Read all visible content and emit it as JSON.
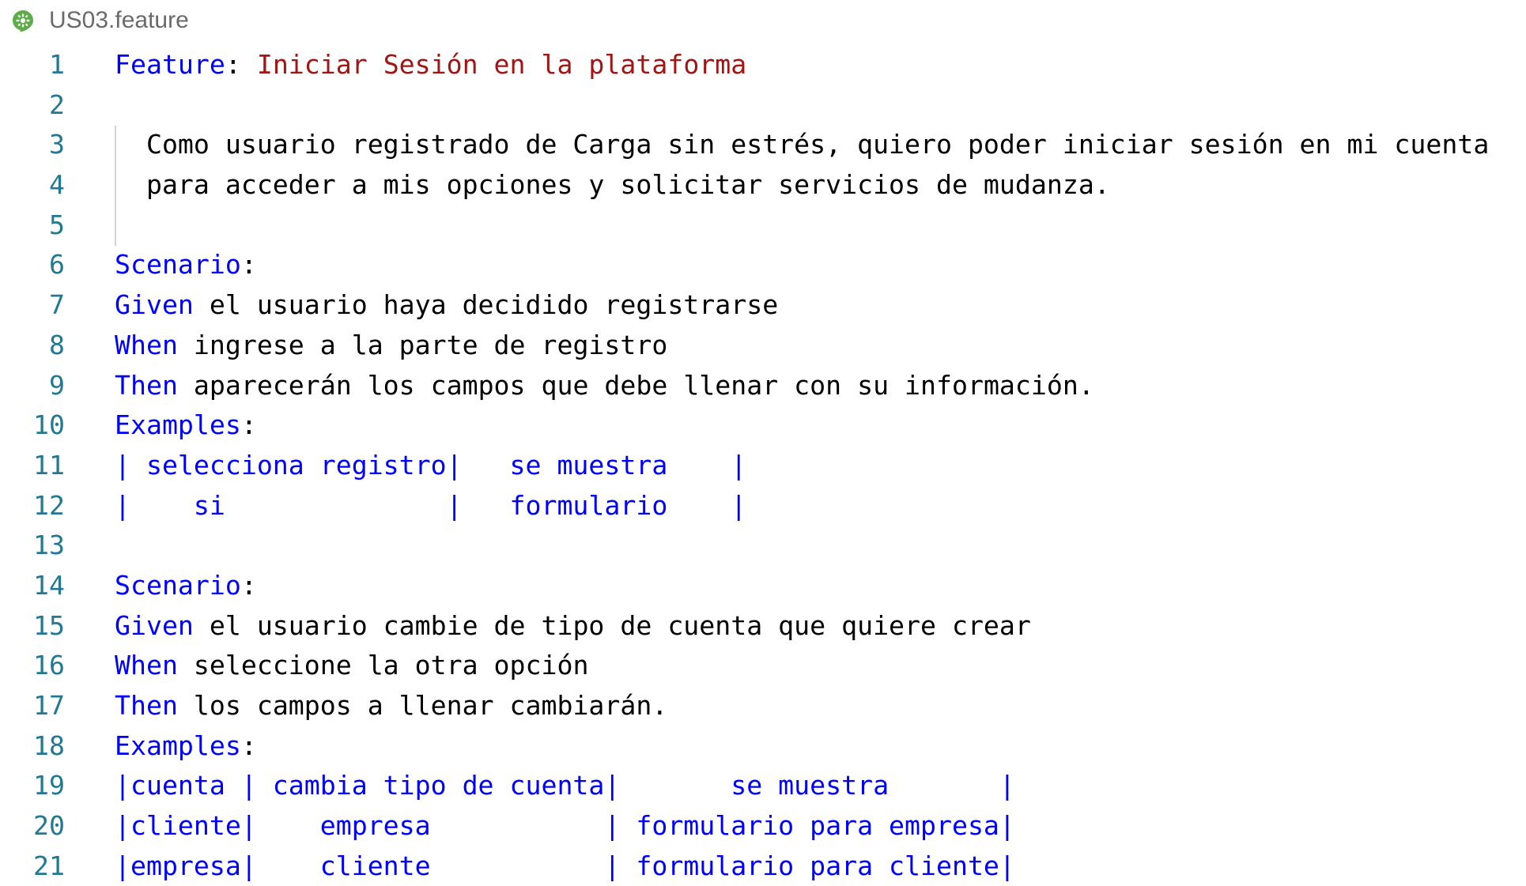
{
  "tab": {
    "icon": "cucumber-icon",
    "file_name": "US03.feature"
  },
  "colors": {
    "keyword": "#0000ff",
    "feature_title": "#a31515",
    "line_number": "#237893",
    "text": "#000000"
  },
  "lines": [
    {
      "n": "1",
      "kw": "Feature",
      "sep": ": ",
      "title": "Iniciar Sesión en la plataforma"
    },
    {
      "n": "2"
    },
    {
      "n": "3",
      "text": "  Como usuario registrado de Carga sin estrés, quiero poder iniciar sesión en mi cuenta"
    },
    {
      "n": "4",
      "text": "  para acceder a mis opciones y solicitar servicios de mudanza."
    },
    {
      "n": "5"
    },
    {
      "n": "6",
      "kw": "Scenario",
      "rest": ":"
    },
    {
      "n": "7",
      "kw": "Given",
      "rest": " el usuario haya decidido registrarse"
    },
    {
      "n": "8",
      "kw": "When",
      "rest": " ingrese a la parte de registro"
    },
    {
      "n": "9",
      "kw": "Then",
      "rest": " aparecerán los campos que debe llenar con su información."
    },
    {
      "n": "10",
      "kw": "Examples",
      "rest": ":"
    },
    {
      "n": "11",
      "table": "| selecciona registro|   se muestra    |"
    },
    {
      "n": "12",
      "table": "|    si              |   formulario    |"
    },
    {
      "n": "13"
    },
    {
      "n": "14",
      "kw": "Scenario",
      "rest": ":"
    },
    {
      "n": "15",
      "kw": "Given",
      "rest": " el usuario cambie de tipo de cuenta que quiere crear"
    },
    {
      "n": "16",
      "kw": "When",
      "rest": " seleccione la otra opción"
    },
    {
      "n": "17",
      "kw": "Then",
      "rest": " los campos a llenar cambiarán."
    },
    {
      "n": "18",
      "kw": "Examples",
      "rest": ":"
    },
    {
      "n": "19",
      "table": "|cuenta | cambia tipo de cuenta|       se muestra       |"
    },
    {
      "n": "20",
      "table": "|cliente|    empresa           | formulario para empresa|"
    },
    {
      "n": "21",
      "table": "|empresa|    cliente           | formulario para cliente|"
    }
  ]
}
